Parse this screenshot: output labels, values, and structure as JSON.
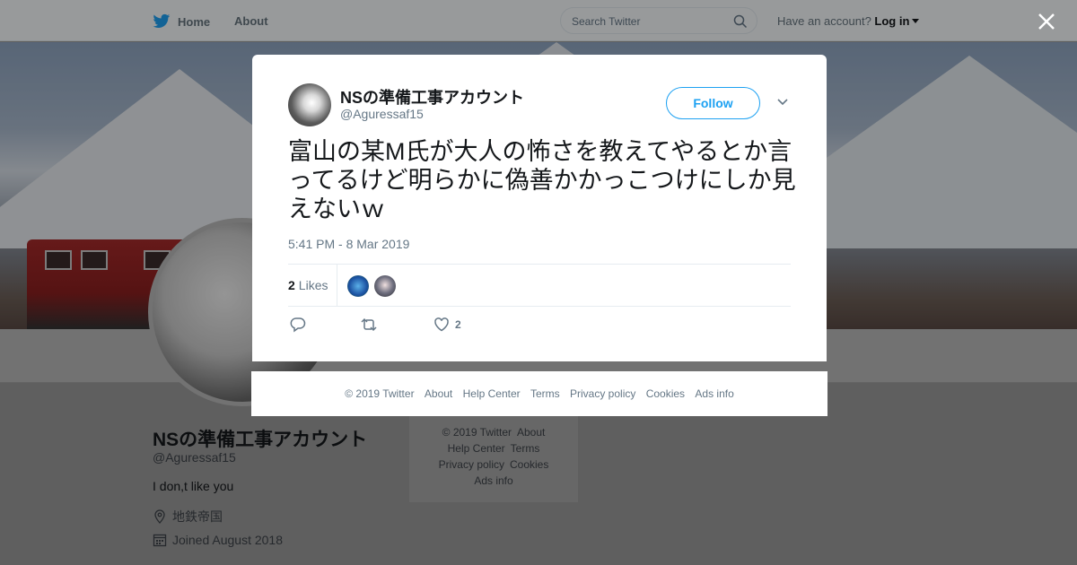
{
  "topbar": {
    "home": "Home",
    "about": "About",
    "search_placeholder": "Search Twitter",
    "account_prompt": "Have an account?",
    "login": "Log in"
  },
  "profile": {
    "name": "NSの準備工事アカウント",
    "handle": "@Aguressaf15",
    "bio": "I don,t like you",
    "location": "地鉄帝国",
    "joined": "Joined August 2018"
  },
  "side_footer": {
    "row1": [
      "© 2019 Twitter",
      "About"
    ],
    "row2": [
      "Help Center",
      "Terms"
    ],
    "row3": [
      "Privacy policy",
      "Cookies"
    ],
    "row4": [
      "Ads info"
    ]
  },
  "tweet": {
    "name": "NSの準備工事アカウント",
    "handle": "@Aguressaf15",
    "follow": "Follow",
    "text": "富山の某M氏が大人の怖さを教えてやるとか言ってるけど明らかに偽善かかっこつけにしか見えないｗ",
    "time": "5:41 PM - 8 Mar 2019",
    "likes_count": "2",
    "likes_label": "Likes",
    "like_action_count": "2"
  },
  "modal_footer": [
    "© 2019 Twitter",
    "About",
    "Help Center",
    "Terms",
    "Privacy policy",
    "Cookies",
    "Ads info"
  ],
  "colors": {
    "accent": "#1da1f2",
    "secondary_text": "#657786"
  },
  "icons": [
    "twitter-bird-icon",
    "search-icon",
    "close-icon",
    "chevron-down-icon",
    "reply-icon",
    "retweet-icon",
    "heart-icon",
    "location-pin-icon",
    "calendar-icon"
  ]
}
